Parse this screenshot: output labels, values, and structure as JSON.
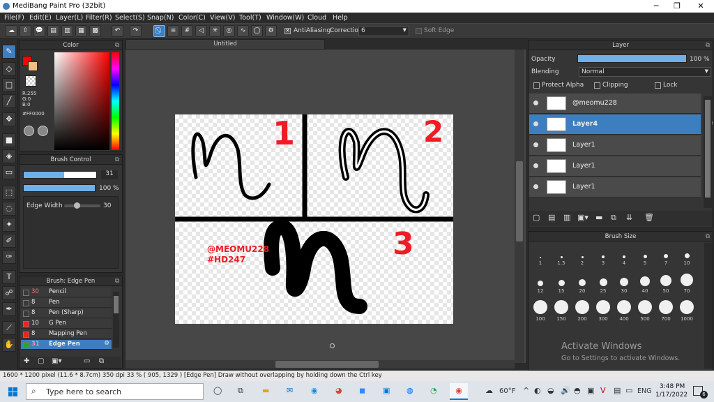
{
  "window": {
    "title": "MediBang Paint Pro (32bit)"
  },
  "menu": [
    "File(F)",
    "Edit(E)",
    "Layer(L)",
    "Filter(R)",
    "Select(S)",
    "Snap(N)",
    "Color(C)",
    "View(V)",
    "Tool(T)",
    "Window(W)",
    "Cloud",
    "Help"
  ],
  "toolbar": {
    "antialiasing": "AntiAliasing",
    "correction_label": "Correction",
    "correction_value": "6",
    "soft_edge": "Soft Edge"
  },
  "color_panel": {
    "title": "Color",
    "r": "R:255",
    "g": "G:0",
    "b": "B:0",
    "hex": "#FF0000",
    "primary": "#ff0000",
    "secondary": "#f0c080"
  },
  "brush_control": {
    "title": "Brush Control",
    "size": "31",
    "opacity": "100 %",
    "size_fill": 0.31,
    "opacity_fill": 1.0,
    "edge_width_label": "Edge Width",
    "edge_width": "30"
  },
  "brush_list": {
    "title": "Brush: Edge Pen",
    "items": [
      {
        "size": "30",
        "name": "Pencil",
        "color": "#333333"
      },
      {
        "size": "8",
        "name": "Pen",
        "color": "#333333"
      },
      {
        "size": "8",
        "name": "Pen (Sharp)",
        "color": "#333333"
      },
      {
        "size": "10",
        "name": "G Pen",
        "color": "#ee2222"
      },
      {
        "size": "8",
        "name": "Mapping Pen",
        "color": "#ee2222"
      },
      {
        "size": "31",
        "name": "Edge Pen",
        "color": "#22aa22"
      }
    ]
  },
  "canvas": {
    "tab_title": "Untitled",
    "watermark": "@MEOMU228",
    "hashtag": "#HD247",
    "num1": "1",
    "num2": "2",
    "num3": "3"
  },
  "layer_panel": {
    "title": "Layer",
    "opacity_label": "Opacity",
    "opacity_value": "100 %",
    "opacity_fill": 1.0,
    "blending_label": "Blending",
    "blending_value": "Normal",
    "protect_alpha": "Protect Alpha",
    "clipping": "Clipping",
    "lock": "Lock",
    "layers": [
      {
        "name": "@meomu228"
      },
      {
        "name": "Layer4"
      },
      {
        "name": "Layer1"
      },
      {
        "name": "Layer1"
      },
      {
        "name": "Layer1"
      }
    ]
  },
  "brush_size": {
    "title": "Brush Size",
    "sizes": [
      "1",
      "1.5",
      "2",
      "3",
      "4",
      "5",
      "7",
      "10",
      "12",
      "15",
      "20",
      "25",
      "30",
      "40",
      "50",
      "70",
      "100",
      "150",
      "200",
      "300",
      "400",
      "500",
      "700",
      "1000"
    ]
  },
  "activation": {
    "line1": "Activate Windows",
    "line2": "Go to Settings to activate Windows."
  },
  "status": {
    "text": "1600 * 1200 pixel   (11.6 * 8.7cm)   350 dpi   33 %   ( 905, 1329 )   [Edge Pen] Draw without overlapping by holding down the Ctrl key"
  },
  "taskbar": {
    "search_placeholder": "Type here to search",
    "temperature": "60°F",
    "lang": "ENG",
    "time": "3:48 PM",
    "date": "1/17/2022",
    "notif_count": "6"
  }
}
